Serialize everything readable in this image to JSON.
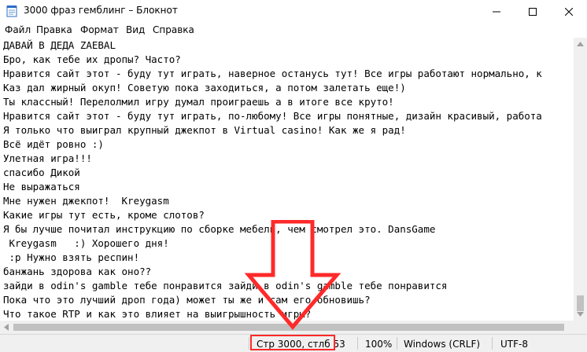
{
  "window": {
    "title": "3000 фраз гемблинг – Блокнот",
    "controls": [
      "minimize",
      "maximize",
      "close"
    ]
  },
  "menu": {
    "items": [
      "Файл",
      "Правка",
      "Формат",
      "Вид",
      "Справка"
    ]
  },
  "editor": {
    "lines": [
      "ДАВАЙ В ДЕДА ZAEBAL",
      "Бро, как тебе их дропы? Часто?",
      "Нравится сайт этот - буду тут играть, наверное останусь тут! Все игры работают нормально, к",
      "Каз дал жирный окуп! Советую пока заходиться, а потом залетать еще!)",
      "Ты классный! Перелолмил игру думал проиграешь а в итоге все круто!",
      "Нравится сайт этот - буду тут играть, по-любому! Все игры понятные, дизайн красивый, работа",
      "Я только что выиграл крупный джекпот в Virtual casino! Как же я рад!",
      "Всё идёт ровно :)",
      "Улетная игра!!!",
      "спасибо Дикой",
      "Не выражаться",
      "Мне нужен джекпот!  Kreygasm",
      "Какие игры тут есть, кроме слотов?",
      "Я бы лучше почитал инструкцию по сборке мебели, чем смотрел это. DansGame",
      " Kreygasm   :) Хорошего дня!",
      " :р Нужно взять респин!",
      "банжань здорова как оно??",
      "зайди в odin's gamble тебе понравится зайди в odin's gamble тебе понравится",
      "Пока что это лучший дроп года) может ты же и сам его обновишь?",
      "Что такое RTP и как это влияет на выигрышность игры?"
    ]
  },
  "status": {
    "position": "Стр 3000, стлб 53",
    "zoom": "100%",
    "line_endings": "Windows (CRLF)",
    "encoding": "UTF-8"
  },
  "annotation": {
    "color": "#ff2a2a",
    "shape": "down-arrow-and-box",
    "target": "status.position"
  }
}
